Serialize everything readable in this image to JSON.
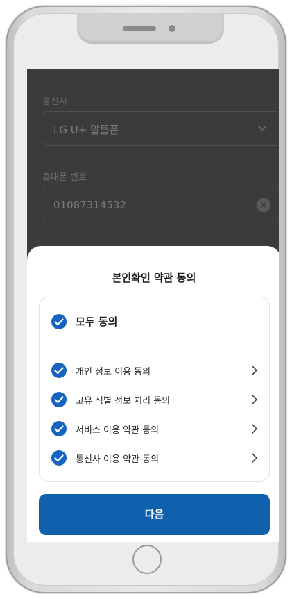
{
  "form": {
    "carrier_label": "통신사",
    "carrier_value": "LG U+ 알뜰폰",
    "phone_label": "휴대폰 번호",
    "phone_value": "01087314532"
  },
  "sheet": {
    "title": "본인확인 약관 동의",
    "agree_all_label": "모두 동의",
    "terms": [
      {
        "label": "개인 정보 이용 동의",
        "checked": true
      },
      {
        "label": "고유 식별 정보 처리 동의",
        "checked": true
      },
      {
        "label": "서비스 이용 약관 동의",
        "checked": true
      },
      {
        "label": "통신사 이용 약관 동의",
        "checked": true
      }
    ],
    "agree_all_checked": true,
    "next_label": "다음"
  },
  "icons": {
    "check": "check-circle-icon",
    "chevron_right": "chevron-right-icon",
    "chevron_down": "chevron-down-icon",
    "clear": "clear-icon"
  },
  "colors": {
    "accent": "#0f60ad",
    "check_fill": "#1565c0"
  }
}
